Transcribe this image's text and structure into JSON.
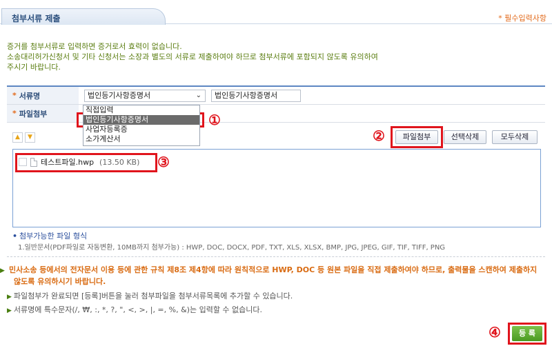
{
  "header": {
    "title": "첨부서류 제출",
    "required_note": "* 필수입력사항"
  },
  "intro": {
    "line1": "증거를 첨부서류로 입력하면 증거로서 효력이 없습니다.",
    "line2": "소송대리허가신청서 및 기타 신청서는 소장과 별도의 서류로 제출하여야 하므로 첨부서류에 포함되지 않도록 유의하여",
    "line3": "주시기 바랍니다."
  },
  "form": {
    "doc_name_label": "서류명",
    "doc_name_selected": "법인등기사항증명서",
    "doc_name_input": "법인등기사항증명서",
    "attach_label": "파일첨부"
  },
  "dropdown": {
    "options": [
      "직접입력",
      "법인등기사항증명서",
      "사업자등록증",
      "소가계산서"
    ],
    "selected_index": 1
  },
  "toolbar": {
    "attach_button": "파일첨부",
    "delete_selected_button": "선택삭제",
    "delete_all_button": "모두삭제"
  },
  "files": [
    {
      "name": "테스트파일.hwp",
      "size": "(13.50 KB)"
    }
  ],
  "formats": {
    "title": "첨부가능한 파일 형식",
    "list": "1.일반문서(PDF파일로 자동변환, 10MB까지 첨부가능) : HWP, DOC, DOCX, PDF, TXT, XLS, XLSX, BMP, JPG, JPEG, GIF, TIF, TIFF, PNG"
  },
  "notices": {
    "main": "민사소송 등에서의 전자문서 이용 등에 관한 규칙 제8조 제4항에 따라 원칙적으로 HWP, DOC 등 원본 파일을 직접 제출하여야 하므로, 출력물을 스캔하여 제출하지 않도록 유의하시기 바랍니다.",
    "sub1": "파일첨부가 완료되면 [등록]버튼을 눌러 첨부파일을 첨부서류목록에 추가할 수 있습니다.",
    "sub2": "서류명에 특수문자(/, ₩, :, *, ?, \", <, >, |, =, %, &)는 입력할 수 없습니다."
  },
  "submit_button": "등 록",
  "annotations": {
    "m1": "①",
    "m2": "②",
    "m3": "③",
    "m4": "④"
  },
  "colors": {
    "accent_blue": "#5c86c2",
    "required_orange": "#e26a1b",
    "notice_green": "#5a7d10",
    "submit_green": "#4a9a22",
    "annotation_red": "#e0141c"
  }
}
